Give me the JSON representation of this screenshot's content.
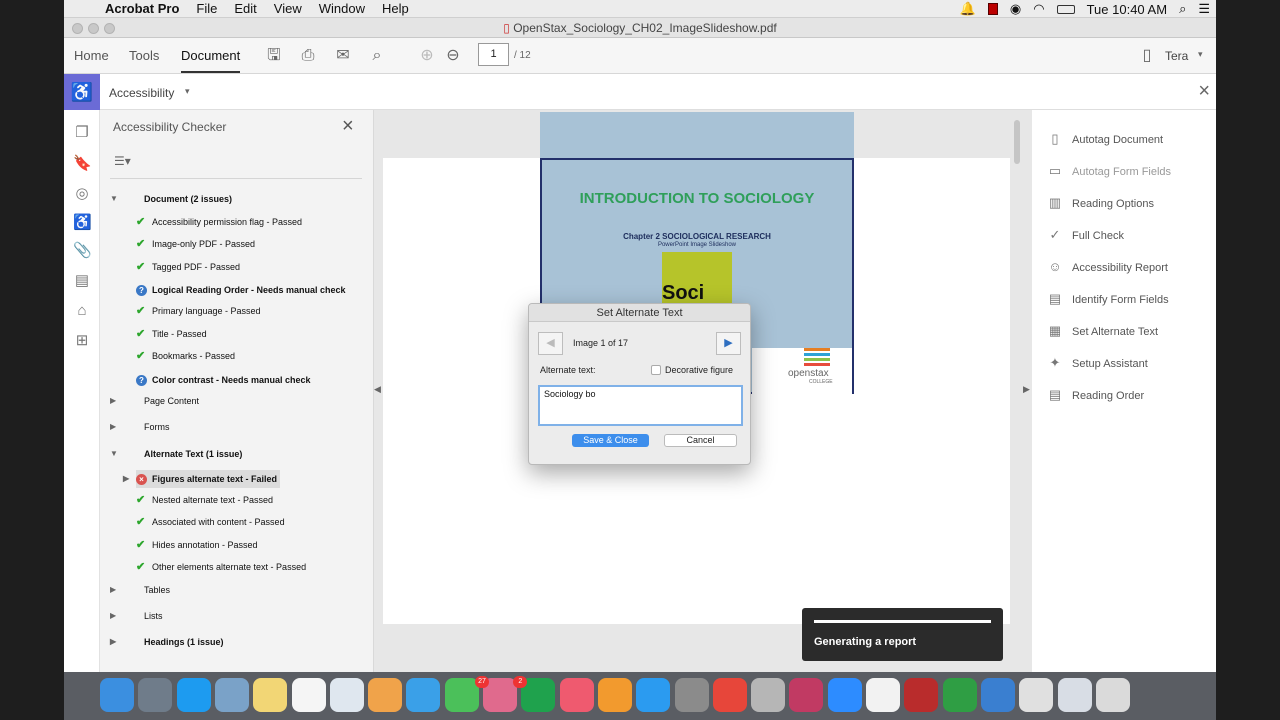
{
  "menubar": {
    "apple": "",
    "app": "Acrobat Pro",
    "items": [
      "File",
      "Edit",
      "View",
      "Window",
      "Help"
    ],
    "clock": "Tue 10:40 AM"
  },
  "window": {
    "title": "OpenStax_Sociology_CH02_ImageSlideshow.pdf"
  },
  "toolbar": {
    "tabs": [
      "Home",
      "Tools",
      "Document"
    ],
    "page_current": "1",
    "page_total": "/ 12",
    "user": "Tera"
  },
  "subbar": {
    "tool": "Accessibility"
  },
  "checker": {
    "title": "Accessibility Checker",
    "rows": [
      {
        "label": "Document (2 issues)",
        "type": "group-open"
      },
      {
        "label": "Accessibility permission flag - Passed",
        "type": "ok"
      },
      {
        "label": "Image-only PDF - Passed",
        "type": "ok"
      },
      {
        "label": "Tagged PDF - Passed",
        "type": "ok"
      },
      {
        "label": "Logical Reading Order - Needs manual check",
        "type": "q"
      },
      {
        "label": "Primary language - Passed",
        "type": "ok"
      },
      {
        "label": "Title - Passed",
        "type": "ok"
      },
      {
        "label": "Bookmarks - Passed",
        "type": "ok"
      },
      {
        "label": "Color contrast - Needs manual check",
        "type": "q"
      },
      {
        "label": "Page Content",
        "type": "group-closed"
      },
      {
        "label": "Forms",
        "type": "group-closed"
      },
      {
        "label": "Alternate Text (1 issue)",
        "type": "group-open"
      },
      {
        "label": "Figures alternate text - Failed",
        "type": "x"
      },
      {
        "label": "Nested alternate text - Passed",
        "type": "ok"
      },
      {
        "label": "Associated with content - Passed",
        "type": "ok"
      },
      {
        "label": "Hides annotation - Passed",
        "type": "ok"
      },
      {
        "label": "Other elements alternate text - Passed",
        "type": "ok"
      },
      {
        "label": "Tables",
        "type": "group-closed"
      },
      {
        "label": "Lists",
        "type": "group-closed"
      },
      {
        "label": "Headings (1 issue)",
        "type": "group-closed"
      }
    ]
  },
  "slide": {
    "title": "INTRODUCTION TO SOCIOLOGY",
    "subtitle": "Chapter 2 SOCIOLOGICAL RESEARCH",
    "subsubtitle": "PowerPoint Image Slideshow",
    "book_word": "Soci",
    "logo_top": "openstax",
    "logo_bottom": "COLLEGE"
  },
  "dialog": {
    "title": "Set Alternate Text",
    "counter": "Image 1 of 17",
    "alt_label": "Alternate text:",
    "decorative_label": "Decorative figure",
    "alt_value": "Sociology bo",
    "save_label": "Save & Close",
    "cancel_label": "Cancel"
  },
  "right_panel": {
    "items": [
      {
        "label": "Autotag Document",
        "icon": "autotag-icon"
      },
      {
        "label": "Autotag Form Fields",
        "icon": "form-autotag-icon"
      },
      {
        "label": "Reading Options",
        "icon": "reading-options-icon"
      },
      {
        "label": "Full Check",
        "icon": "check-circle-icon"
      },
      {
        "label": "Accessibility Report",
        "icon": "accessibility-icon"
      },
      {
        "label": "Identify Form Fields",
        "icon": "form-fields-icon"
      },
      {
        "label": "Set Alternate Text",
        "icon": "alt-text-icon"
      },
      {
        "label": "Setup Assistant",
        "icon": "wand-icon"
      },
      {
        "label": "Reading Order",
        "icon": "reading-order-icon"
      }
    ]
  },
  "toast": {
    "text": "Generating a report"
  },
  "dock": {
    "badges": {
      "messages": "27",
      "facetime": "2"
    },
    "colors": [
      "#3b8fe0",
      "#6f7c8a",
      "#1d9bf0",
      "#7aa2c8",
      "#f2d675",
      "#f5f5f5",
      "#dfe7ef",
      "#f0a34a",
      "#3aa0e8",
      "#4bc05a",
      "#e06a8d",
      "#1fa24d",
      "#ef5a6f",
      "#f29a2e",
      "#2b9bf0",
      "#8b8b8b",
      "#e7463a",
      "#b6b6b6",
      "#c13a63",
      "#2d8cff",
      "#f2f2f2",
      "#b92c2c",
      "#2f9e44",
      "#3a7fd0",
      "#e0e0e0",
      "#d8dde5",
      "#dadada"
    ]
  }
}
